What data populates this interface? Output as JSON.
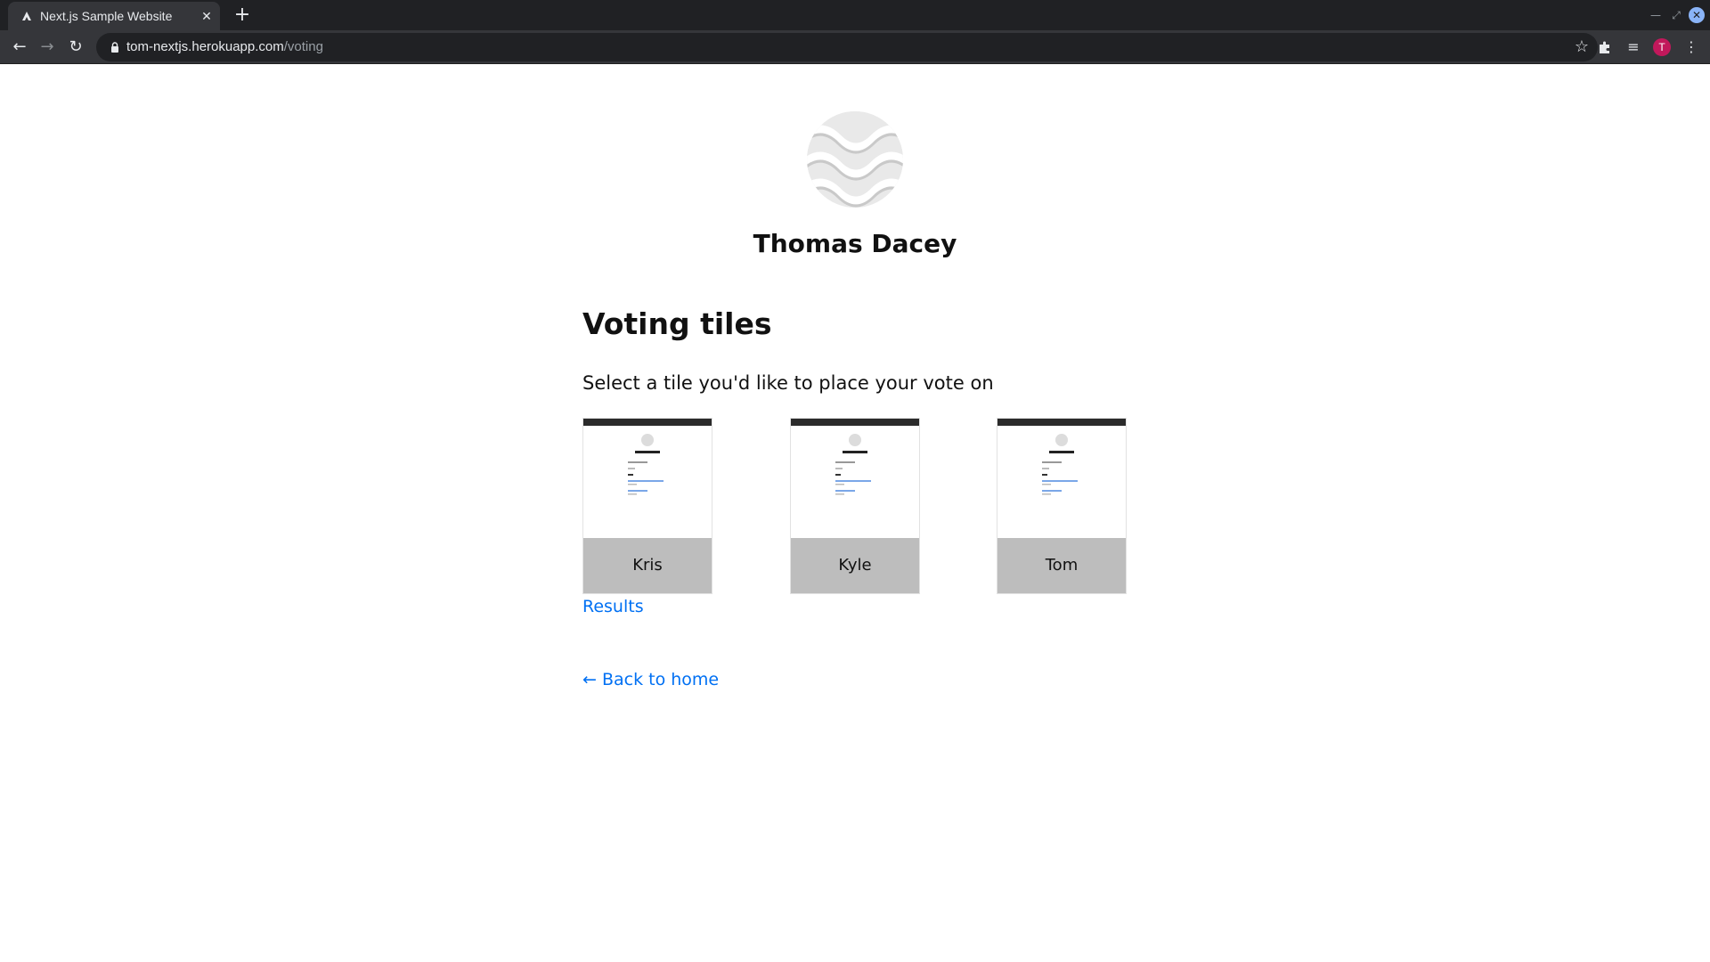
{
  "browser": {
    "tab_title": "Next.js Sample Website",
    "url_host": "tom-nextjs.herokuapp.com",
    "url_path": "/voting",
    "profile_initial": "T"
  },
  "page": {
    "name": "Thomas Dacey",
    "heading": "Voting tiles",
    "subtitle": "Select a tile you'd like to place your vote on",
    "tiles": [
      {
        "label": "Kris"
      },
      {
        "label": "Kyle"
      },
      {
        "label": "Tom"
      }
    ],
    "results_link": "Results",
    "back_link": "← Back to home"
  },
  "colors": {
    "link": "#0070f3",
    "tile_label_bg": "#bdbdbd",
    "chrome_dark": "#202124",
    "chrome_toolbar": "#35363a",
    "avatar": "#c2185b"
  }
}
